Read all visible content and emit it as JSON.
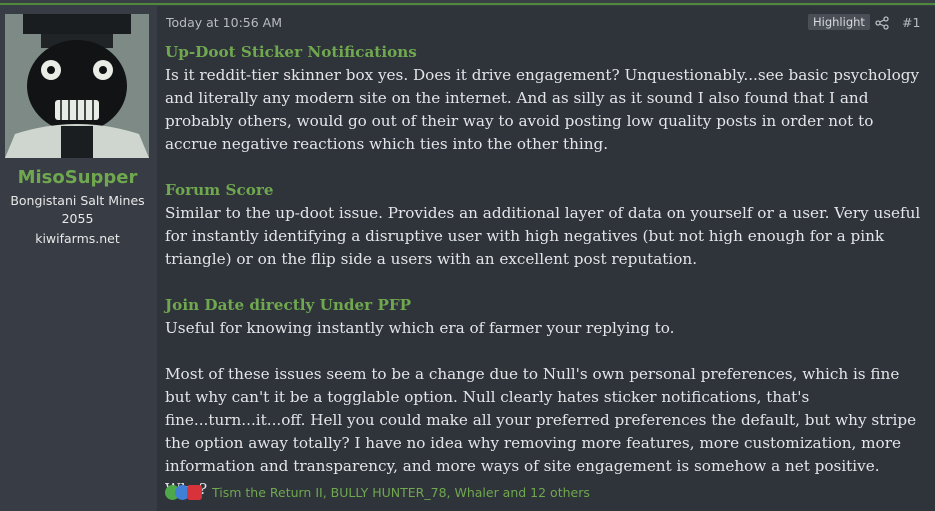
{
  "user": {
    "name": "MisoSupper",
    "title": "Bongistani Salt Mines",
    "location": "2055",
    "site": "kiwifarms.net"
  },
  "post": {
    "time": "Today at 10:56 AM",
    "highlight_label": "Highlight",
    "number": "#1",
    "sections": [
      {
        "heading": "Up-Doot Sticker Notifications",
        "text": "Is it reddit-tier skinner box yes. Does it drive engagement? Unquestionably...see basic psychology and literally any modern site on the internet. And as silly as it sound I also found that I and probably others, would go out of their way to avoid posting low quality posts in order not to accrue negative reactions which ties into the other thing."
      },
      {
        "heading": "Forum Score",
        "text": "Similar to the up-doot issue. Provides an additional layer of data on yourself or a user. Very useful for instantly identifying a disruptive user with high negatives (but not high enough for a pink triangle) or on the flip side a users with an excellent post reputation."
      },
      {
        "heading": "Join Date directly Under PFP",
        "text": "Useful for knowing instantly which era of farmer your replying to."
      }
    ],
    "closing": "Most of these issues seem to be a change due to Null's own personal preferences, which is fine but why can't it be a togglable option. Null clearly hates sticker notifications, that's fine...turn...it...off. Hell you could make all your preferred preferences the default, but why stripe the option away totally? I have no idea why removing more features, more customization, more information and transparency, and more ways of site engagement is somehow a net positive. Why?"
  },
  "reactions": {
    "icons": [
      "check-reaction-icon",
      "like-reaction-icon",
      "heart-reaction-icon"
    ],
    "text": "Tism the Return II, BULLY HUNTER_78, Whaler and 12 others"
  }
}
